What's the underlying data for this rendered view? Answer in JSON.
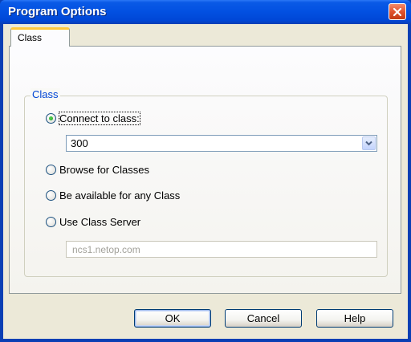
{
  "window": {
    "title": "Program Options"
  },
  "tabs": [
    {
      "label": "Class",
      "selected": true
    }
  ],
  "group": {
    "title": "Class",
    "options": [
      {
        "label": "Connect to class:",
        "checked": true
      },
      {
        "label": "Browse for Classes",
        "checked": false
      },
      {
        "label": "Be available for any Class",
        "checked": false
      },
      {
        "label": "Use Class Server",
        "checked": false
      }
    ],
    "class_combo": {
      "value": "300"
    },
    "class_server": {
      "value": "ncs1.netop.com",
      "disabled": true
    }
  },
  "buttons": {
    "ok": "OK",
    "cancel": "Cancel",
    "help": "Help"
  },
  "colors": {
    "accent": "#0046d5",
    "titlebar": "#0250e1",
    "close": "#e0532e",
    "radio_checked": "#21a121"
  },
  "icons": {
    "close": "close-icon",
    "dropdown": "chevron-down-icon"
  }
}
